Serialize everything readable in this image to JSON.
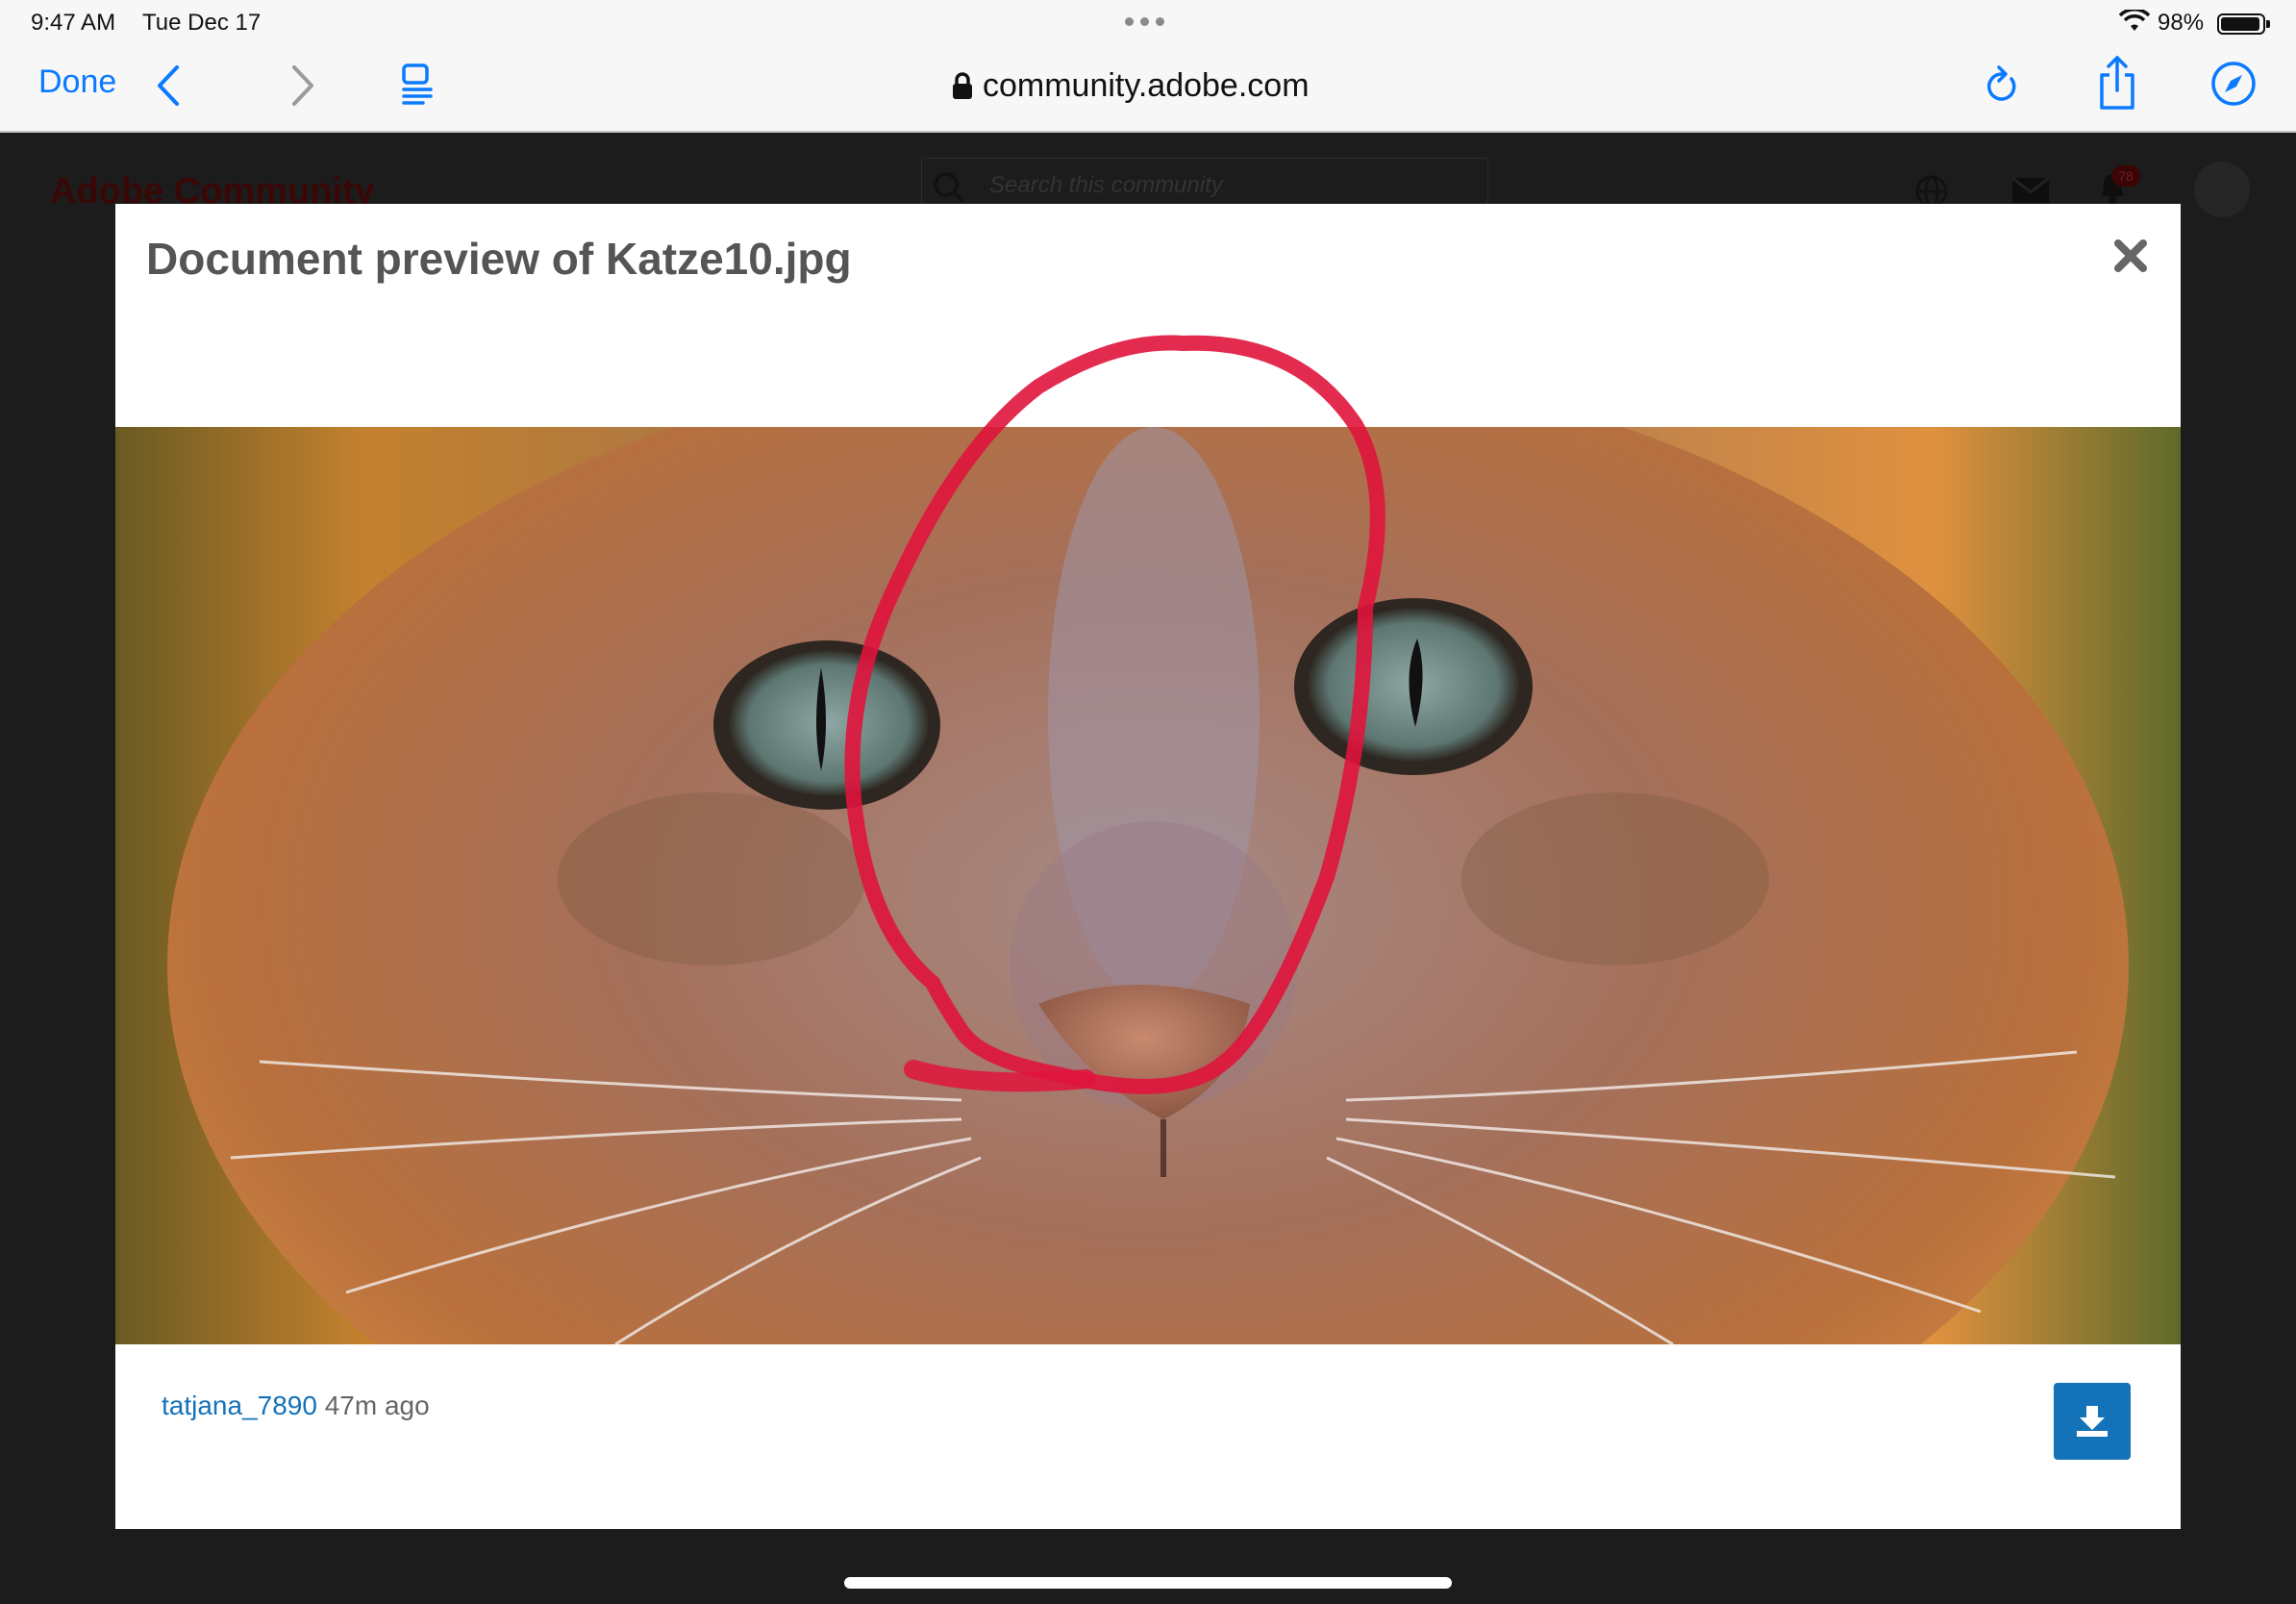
{
  "status_bar": {
    "time": "9:47 AM",
    "date": "Tue Dec 17",
    "battery": "98%",
    "battery_level": 0.98
  },
  "browser": {
    "done_label": "Done",
    "url": "community.adobe.com",
    "icons": [
      "back-icon",
      "forward-icon",
      "bookmarks-icon",
      "lock-icon",
      "reload-icon",
      "share-icon",
      "compass-icon"
    ]
  },
  "page": {
    "brand": "Adobe Community",
    "search_placeholder": "Search this community",
    "notification_count": "78"
  },
  "modal": {
    "title": "Document preview of Katze10.jpg",
    "author": "tatjana_7890",
    "time_ago": "47m ago",
    "image_description": "close-up of an orange tabby cat face with a red hand-drawn circle around the nose and forehead"
  },
  "colors": {
    "accent": "#0a7aff",
    "link": "#1473b8",
    "annotation": "#e0143c"
  }
}
